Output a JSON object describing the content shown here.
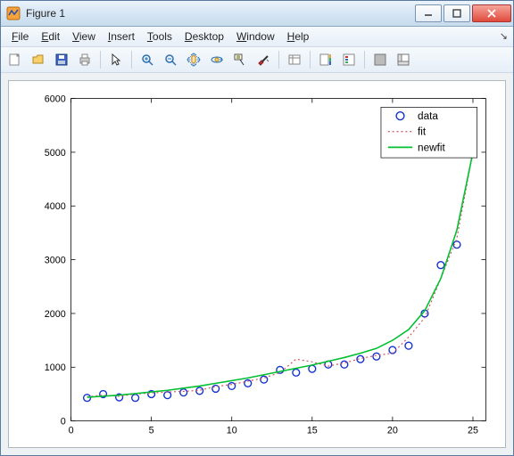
{
  "window": {
    "title": "Figure 1"
  },
  "menus": {
    "file": "File",
    "edit": "Edit",
    "view": "View",
    "insert": "Insert",
    "tools": "Tools",
    "desktop": "Desktop",
    "window": "Window",
    "help": "Help"
  },
  "legend": {
    "data": "data",
    "fit": "fit",
    "newfit": "newfit"
  },
  "chart_data": {
    "type": "line",
    "x": [
      1,
      2,
      3,
      4,
      5,
      6,
      7,
      8,
      9,
      10,
      11,
      12,
      13,
      14,
      15,
      16,
      17,
      18,
      19,
      20,
      21,
      22,
      23,
      24,
      25
    ],
    "series": [
      {
        "name": "data",
        "style": "scatter-circle",
        "color": "#1030d0",
        "values": [
          430,
          500,
          440,
          430,
          500,
          480,
          530,
          560,
          600,
          650,
          700,
          770,
          950,
          900,
          970,
          1050,
          1050,
          1150,
          1200,
          1320,
          1400,
          2000,
          2900,
          3280,
          5350
        ]
      },
      {
        "name": "fit",
        "style": "dotted",
        "color": "#d05060",
        "values": [
          450,
          480,
          460,
          500,
          520,
          540,
          550,
          570,
          640,
          680,
          740,
          800,
          900,
          1150,
          1100,
          1020,
          1080,
          1160,
          1220,
          1260,
          1560,
          1920,
          2650,
          3400,
          5000
        ]
      },
      {
        "name": "newfit",
        "style": "solid",
        "color": "#00c030",
        "values": [
          440,
          460,
          480,
          510,
          540,
          570,
          610,
          650,
          700,
          750,
          800,
          860,
          920,
          980,
          1040,
          1110,
          1180,
          1260,
          1350,
          1500,
          1700,
          2050,
          2650,
          3550,
          5000
        ]
      }
    ],
    "xlim": [
      0,
      25.8
    ],
    "ylim": [
      0,
      6000
    ],
    "xticks": [
      0,
      5,
      10,
      15,
      20,
      25
    ],
    "yticks": [
      0,
      1000,
      2000,
      3000,
      4000,
      5000,
      6000
    ],
    "title": "",
    "xlabel": "",
    "ylabel": ""
  }
}
